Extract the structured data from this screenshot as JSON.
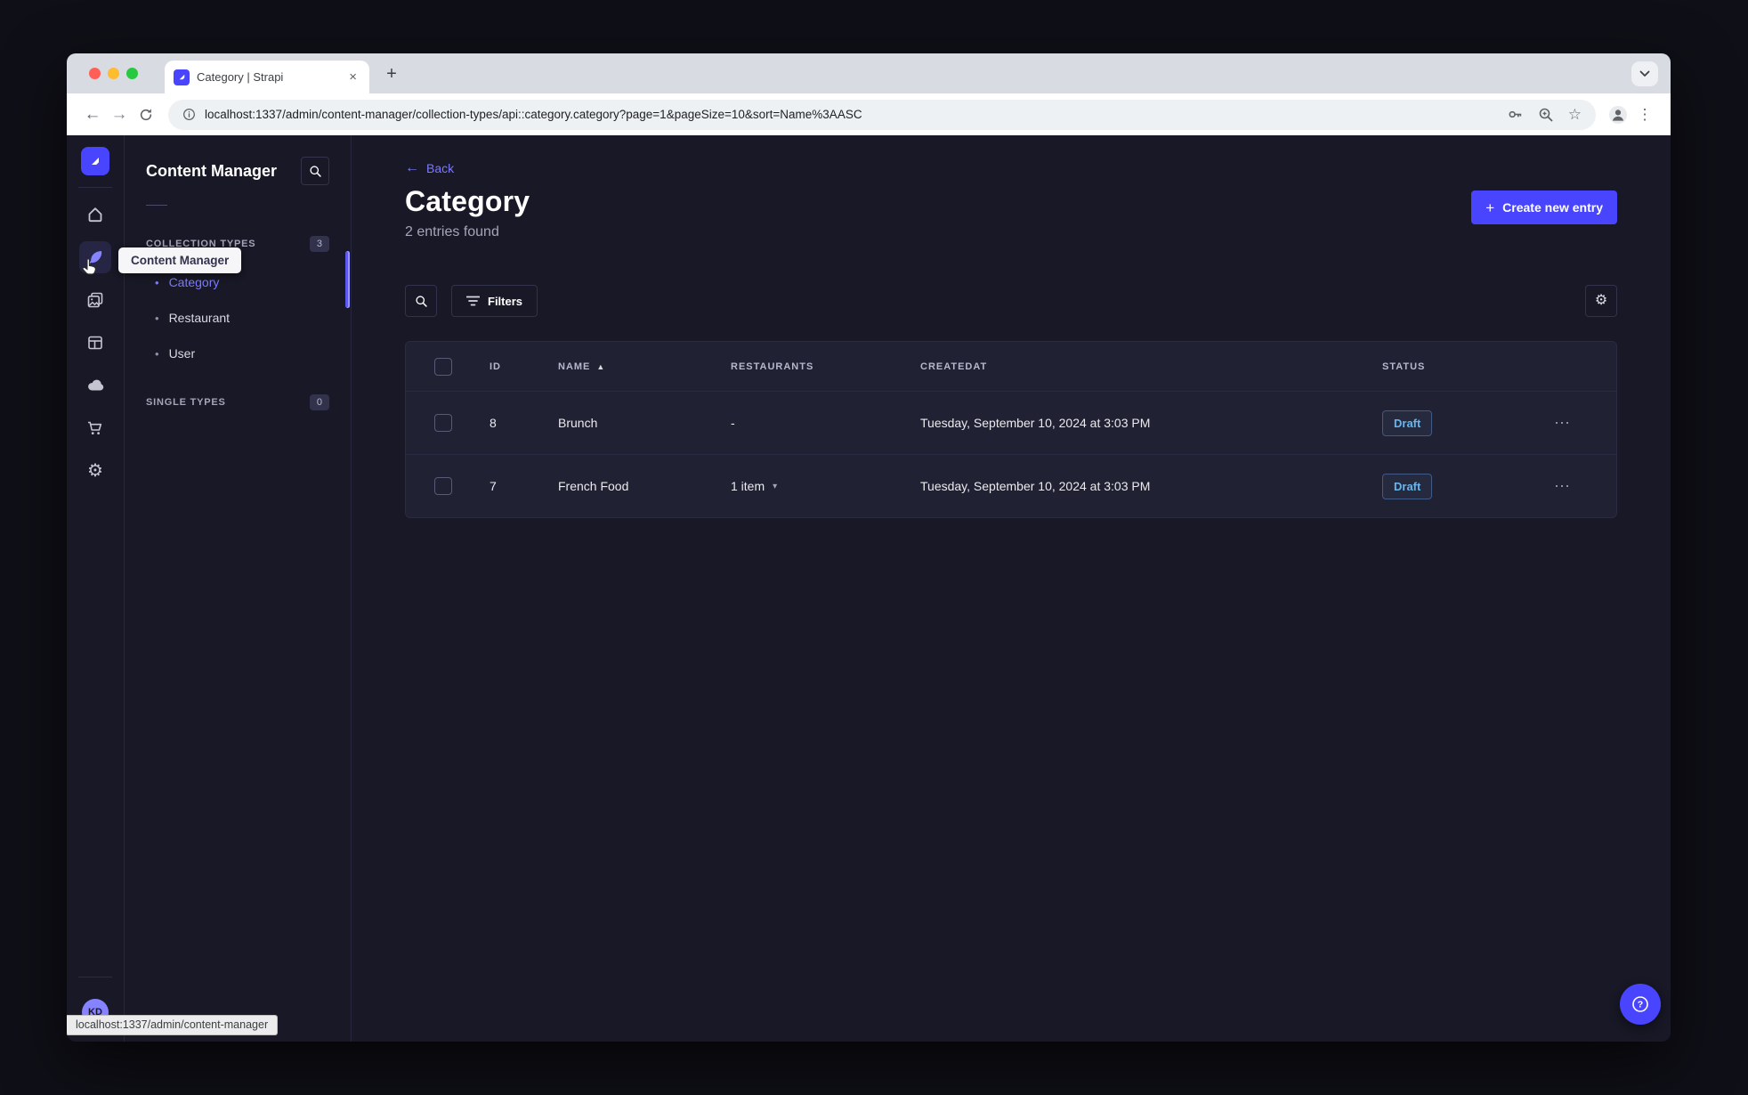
{
  "colors": {
    "primary": "#4945FF",
    "primary_light": "#7B79FF",
    "draft_blue": "#66B7F1",
    "app_bg": "#181826",
    "panel_bg": "#212134",
    "border": "#32324D"
  },
  "glyphs": {
    "close": "×",
    "plus": "+",
    "back_arrow": "←",
    "forward_arrow": "→",
    "star": "☆",
    "vdots": "⋮",
    "hdots": "⋯",
    "sort_asc": "▲",
    "caret_down": "▾",
    "bullet": "•",
    "gear": "⚙",
    "question": "?"
  },
  "browser": {
    "tab_title": "Category | Strapi",
    "url": "localhost:1337/admin/content-manager/collection-types/api::category.category?page=1&pageSize=10&sort=Name%3AASC",
    "status_link": "localhost:1337/admin/content-manager"
  },
  "rail": {
    "avatar_initials": "KD"
  },
  "subnav": {
    "title": "Content Manager",
    "tooltip": "Content Manager",
    "collection_types": {
      "label": "COLLECTION TYPES",
      "badge": "3",
      "items": [
        {
          "label": "Category",
          "active": true
        },
        {
          "label": "Restaurant",
          "active": false
        },
        {
          "label": "User",
          "active": false
        }
      ]
    },
    "single_types": {
      "label": "SINGLE TYPES",
      "badge": "0"
    }
  },
  "main": {
    "back_label": "Back",
    "title": "Category",
    "subtitle": "2 entries found",
    "create_button_label": "Create new entry",
    "filters_button_label": "Filters",
    "table": {
      "columns": [
        "ID",
        "NAME",
        "RESTAURANTS",
        "CREATEDAT",
        "STATUS"
      ],
      "rows": [
        {
          "id": "8",
          "name": "Brunch",
          "restaurants": "-",
          "createdat": "Tuesday, September 10, 2024 at 3:03 PM",
          "status": "Draft"
        },
        {
          "id": "7",
          "name": "French Food",
          "restaurants": "1 item",
          "createdat": "Tuesday, September 10, 2024 at 3:03 PM",
          "status": "Draft"
        }
      ]
    }
  }
}
